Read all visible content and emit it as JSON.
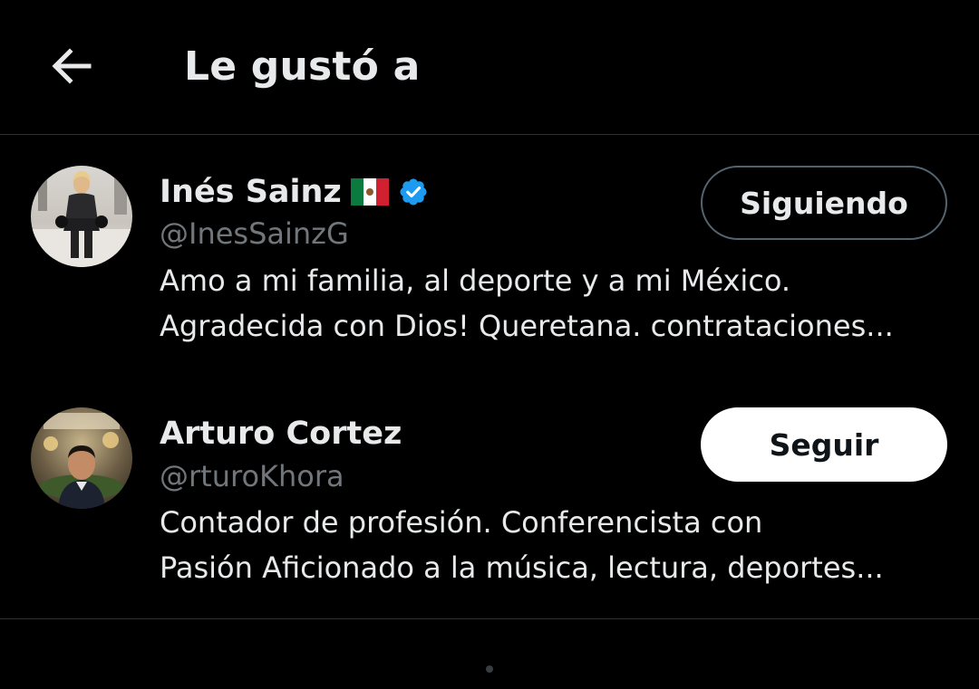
{
  "header": {
    "back_icon": "arrow-left-icon",
    "title": "Le gustó a"
  },
  "users": [
    {
      "name": "Inés Sainz",
      "flag_icon": "mexico-flag-icon",
      "verified_icon": "verified-badge-icon",
      "verified_color": "#1d9bf0",
      "handle": "@InesSainzG",
      "bio_lines": [
        "Amo a mi familia, al deporte y a mi México.",
        "Agradecida con Dios! Queretana. contrataciones..."
      ],
      "button_label": "Siguiendo",
      "avatar_icon": "user-avatar"
    },
    {
      "name": "Arturo Cortez",
      "handle": "@rturoKhora",
      "bio_lines": [
        "Contador de profesión. Conferencista con",
        "Pasión Aficionado a la música, lectura, deportes..."
      ],
      "button_label": "Seguir",
      "avatar_icon": "user-avatar"
    }
  ],
  "colors": {
    "background": "#000000",
    "text_primary": "#e7e9ea",
    "text_secondary": "#71767b",
    "divider": "#2f3336",
    "verified": "#1d9bf0"
  }
}
